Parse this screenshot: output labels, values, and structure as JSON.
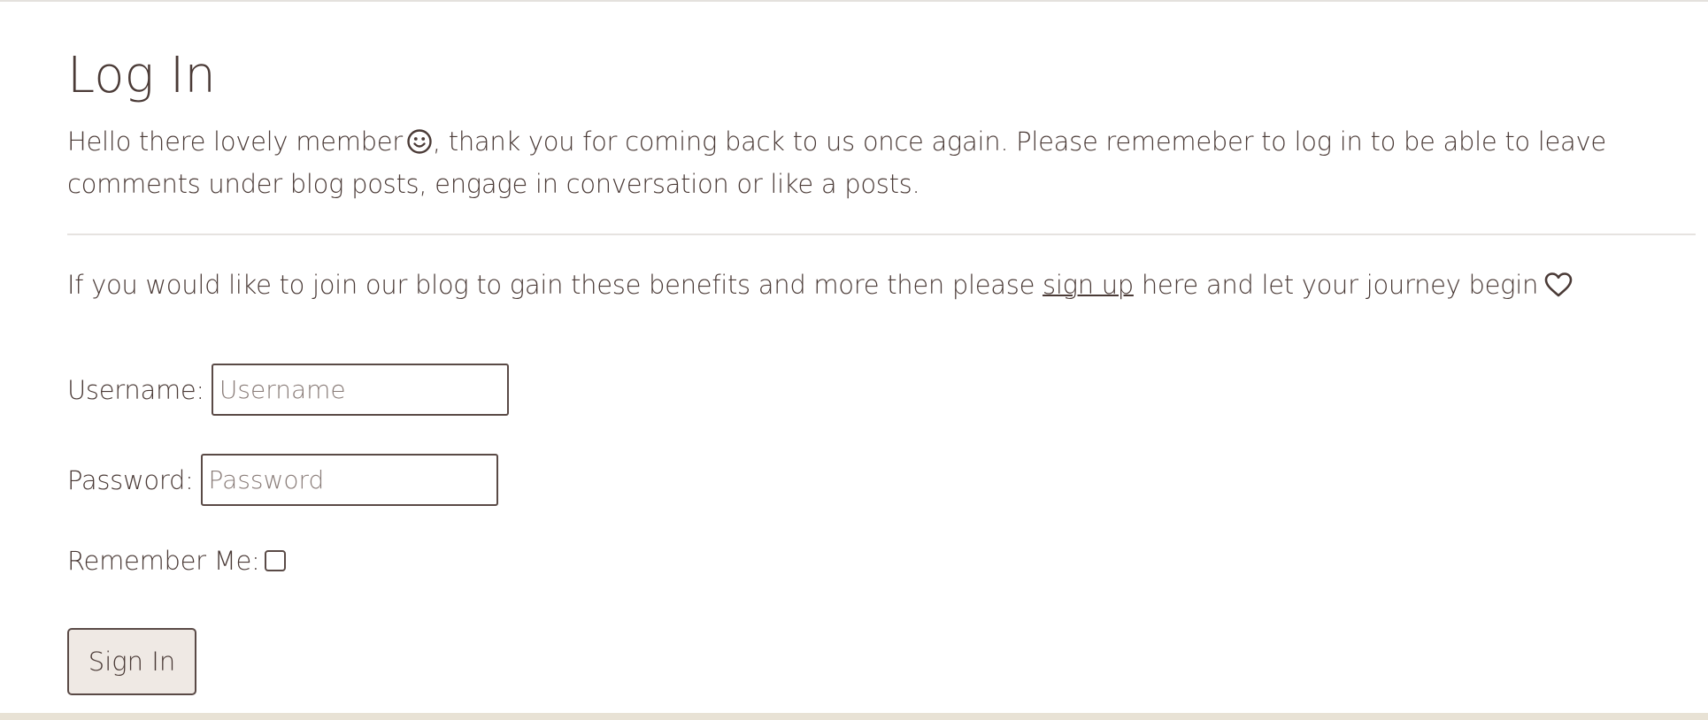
{
  "page": {
    "title": "Log In",
    "intro_part1": "Hello there lovely member",
    "intro_part2": ", thank you for coming back to us once again. Please rememeber to log in to be able to leave comments under blog posts, engage in conversation or like a posts.",
    "smile_icon": "smiley-face-icon",
    "signup_prefix": "If you would like to join our blog to gain these benefits and more then please ",
    "signup_link": "sign up",
    "signup_suffix": " here and let your journey begin",
    "heart_icon": "heart-outline-icon"
  },
  "form": {
    "username_label": "Username:",
    "username_placeholder": "Username",
    "username_value": "",
    "password_label": "Password:",
    "password_placeholder": "Password",
    "password_value": "",
    "remember_label": "Remember Me:",
    "remember_checked": false,
    "submit_label": "Sign In"
  },
  "colors": {
    "text": "#4a3a36",
    "button_bg": "#efe9e4",
    "footer_band": "#e8e2d5",
    "divider": "#e6e3e0"
  }
}
